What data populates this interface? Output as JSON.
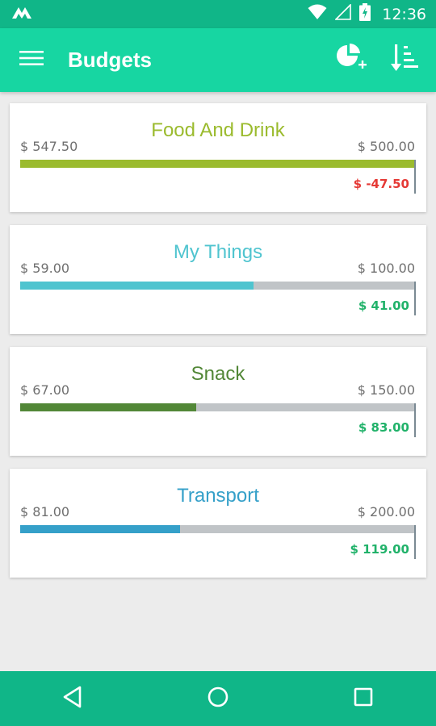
{
  "status_bar": {
    "time": "12:36"
  },
  "app_bar": {
    "title": "Budgets"
  },
  "budgets": [
    {
      "title": "Food And Drink",
      "spent": "$ 547.50",
      "limit": "$ 500.00",
      "remaining": "$ -47.50",
      "progress": 1.0,
      "color": "#9bbb2e",
      "remaining_color": "#e53935"
    },
    {
      "title": "My Things",
      "spent": "$ 59.00",
      "limit": "$ 100.00",
      "remaining": "$ 41.00",
      "progress": 0.59,
      "color": "#4fc4cf",
      "remaining_color": "#21b26a"
    },
    {
      "title": "Snack",
      "spent": "$ 67.00",
      "limit": "$ 150.00",
      "remaining": "$ 83.00",
      "progress": 0.4467,
      "color": "#528737",
      "remaining_color": "#21b26a"
    },
    {
      "title": "Transport",
      "spent": "$ 81.00",
      "limit": "$ 200.00",
      "remaining": "$ 119.00",
      "progress": 0.405,
      "color": "#35a0c9",
      "remaining_color": "#21b26a"
    }
  ],
  "colors": {
    "app_bar": "#17d6a2",
    "status_bar": "#10b688",
    "track": "#c0c4c7"
  },
  "icons": [
    "notification-logo-icon",
    "wifi-icon",
    "signal-icon",
    "battery-icon",
    "menu-icon",
    "add-chart-icon",
    "sort-icon",
    "back-icon",
    "home-icon",
    "recents-icon"
  ]
}
